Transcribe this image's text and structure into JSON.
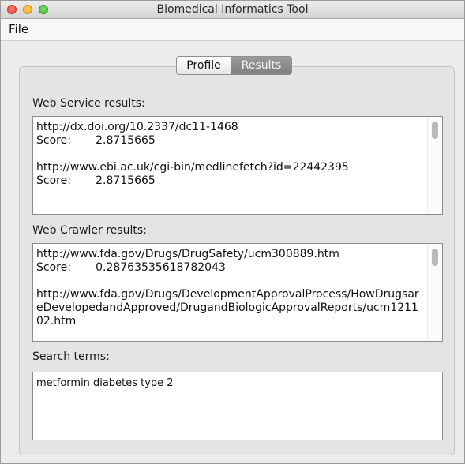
{
  "window": {
    "title": "Biomedical Informatics Tool"
  },
  "menu": {
    "file": "File"
  },
  "tabs": {
    "profile": "Profile",
    "results": "Results"
  },
  "web_service": {
    "label": "Web Service results:",
    "entries": [
      {
        "url": "http://dx.doi.org/10.2337/dc11-1468",
        "score_label": "Score:",
        "score": "2.8715665"
      },
      {
        "url": "http://www.ebi.ac.uk/cgi-bin/medlinefetch?id=22442395",
        "score_label": "Score:",
        "score": "2.8715665"
      }
    ]
  },
  "web_crawler": {
    "label": "Web Crawler results:",
    "entries": [
      {
        "url": "http://www.fda.gov/Drugs/DrugSafety/ucm300889.htm",
        "score_label": "Score:",
        "score": "0.28763535618782043"
      },
      {
        "url": "http://www.fda.gov/Drugs/DevelopmentApprovalProcess/HowDrugsareDevelopedandApproved/DrugandBiologicApprovalReports/ucm121102.htm"
      }
    ]
  },
  "search_terms": {
    "label": "Search terms:",
    "value": "metformin diabetes type 2"
  }
}
